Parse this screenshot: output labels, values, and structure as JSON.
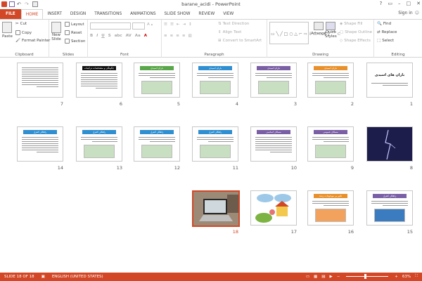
{
  "app": {
    "title": "barane_acidi - PowerPoint",
    "signin": "Sign in",
    "accent": "#d24726"
  },
  "qat": {
    "icons": [
      "powerpoint-logo-icon",
      "save-icon",
      "undo-icon",
      "redo-icon",
      "present-icon"
    ]
  },
  "tabs": [
    {
      "label": "FILE"
    },
    {
      "label": "HOME"
    },
    {
      "label": "INSERT"
    },
    {
      "label": "DESIGN"
    },
    {
      "label": "TRANSITIONS"
    },
    {
      "label": "ANIMATIONS"
    },
    {
      "label": "SLIDE SHOW"
    },
    {
      "label": "REVIEW"
    },
    {
      "label": "VIEW"
    }
  ],
  "ribbon": {
    "clipboard": {
      "label": "Clipboard",
      "paste": "Paste",
      "cut": "Cut",
      "copy": "Copy",
      "format_painter": "Format Painter"
    },
    "slides": {
      "label": "Slides",
      "new_slide": "New",
      "new_slide2": "Slide",
      "layout": "Layout",
      "reset": "Reset",
      "section": "Section"
    },
    "font": {
      "label": "Font"
    },
    "paragraph": {
      "label": "Paragraph",
      "text_direction": "Text Direction",
      "align_text": "Align Text",
      "convert": "Convert to SmartArt"
    },
    "drawing": {
      "label": "Drawing",
      "arrange": "Arrange",
      "quick_styles": "Quick",
      "quick_styles2": "Styles",
      "shape_fill": "Shape Fill",
      "shape_outline": "Shape Outline",
      "shape_effects": "Shape Effects"
    },
    "editing": {
      "label": "Editing",
      "find": "Find",
      "replace": "Replace",
      "select": "Select"
    }
  },
  "slides": [
    {
      "num": "1",
      "title": "باران های اسیدی",
      "style": "title"
    },
    {
      "num": "2",
      "title": "باران اسیدی",
      "style": "orange"
    },
    {
      "num": "3",
      "title": "باران اسیدی",
      "style": "purple"
    },
    {
      "num": "4",
      "title": "باران اسیدی",
      "style": "blue"
    },
    {
      "num": "5",
      "title": "باران اسیدی",
      "style": "green"
    },
    {
      "num": "6",
      "title": "چگونگی و مشخصات ترکیبات باران اسیدی",
      "style": "black"
    },
    {
      "num": "7",
      "title": "",
      "style": "text"
    },
    {
      "num": "8",
      "title": "",
      "style": "lightning"
    },
    {
      "num": "9",
      "title": "مسائل عمومی",
      "style": "purple"
    },
    {
      "num": "10",
      "title": "مسائل اساسی",
      "style": "purple"
    },
    {
      "num": "11",
      "title": "راهکار کنترل",
      "style": "blue"
    },
    {
      "num": "12",
      "title": "راهکار کنترل",
      "style": "blue"
    },
    {
      "num": "13",
      "title": "راهکار کنترل",
      "style": "blue"
    },
    {
      "num": "14",
      "title": "راهکار کنترل",
      "style": "blue"
    },
    {
      "num": "15",
      "title": "راهکار کنترل",
      "style": "purple"
    },
    {
      "num": "16",
      "title": "تاثیر بر موجودات زنده",
      "style": "orange"
    },
    {
      "num": "17",
      "title": "",
      "style": "cartoon"
    },
    {
      "num": "18",
      "title": "",
      "style": "photo"
    }
  ],
  "status": {
    "slide_info": "SLIDE 18 OF 18",
    "language": "ENGLISH (UNITED STATES)",
    "zoom": "63%"
  }
}
